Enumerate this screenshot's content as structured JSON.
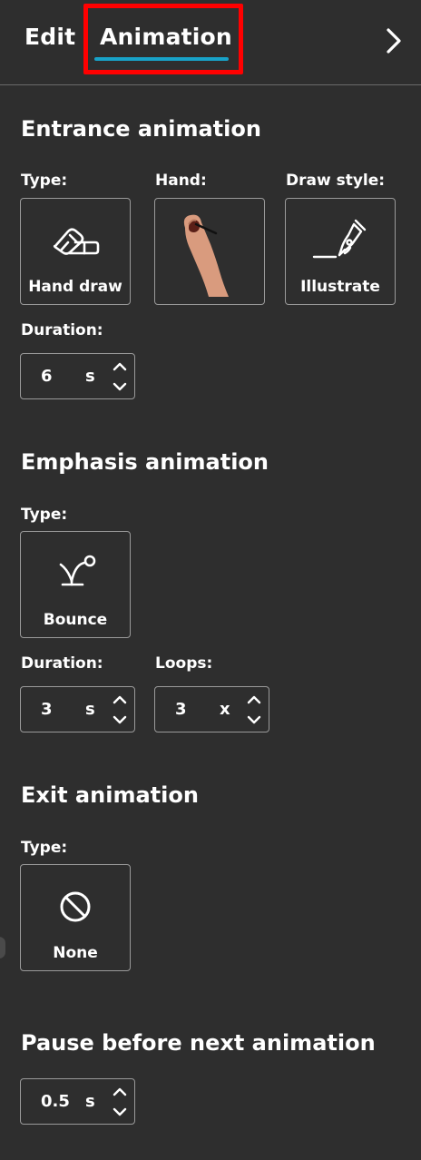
{
  "tabs": {
    "edit_label": "Edit",
    "animation_label": "Animation",
    "active": "Animation"
  },
  "entrance": {
    "title": "Entrance animation",
    "type_label": "Type:",
    "type_value": "Hand draw",
    "hand_label": "Hand:",
    "draw_style_label": "Draw style:",
    "draw_style_value": "Illustrate",
    "duration_label": "Duration:",
    "duration_value": "6",
    "duration_unit": "s"
  },
  "emphasis": {
    "title": "Emphasis animation",
    "type_label": "Type:",
    "type_value": "Bounce",
    "duration_label": "Duration:",
    "duration_value": "3",
    "duration_unit": "s",
    "loops_label": "Loops:",
    "loops_value": "3",
    "loops_unit": "x"
  },
  "exit": {
    "title": "Exit animation",
    "type_label": "Type:",
    "type_value": "None"
  },
  "pause": {
    "title": "Pause before next animation",
    "value": "0.5",
    "unit": "s"
  },
  "colors": {
    "background": "#2e2e2e",
    "accent_underline": "#18a2c8",
    "highlight": "#ff0000",
    "border": "#9a9a9a"
  },
  "icons": {
    "collapse": "chevron-right-icon",
    "hand_draw": "hand-draw-icon",
    "hand": "hand-holding-pen-image",
    "illustrate": "pen-nib-icon",
    "bounce": "bounce-icon",
    "none": "prohibited-icon"
  }
}
